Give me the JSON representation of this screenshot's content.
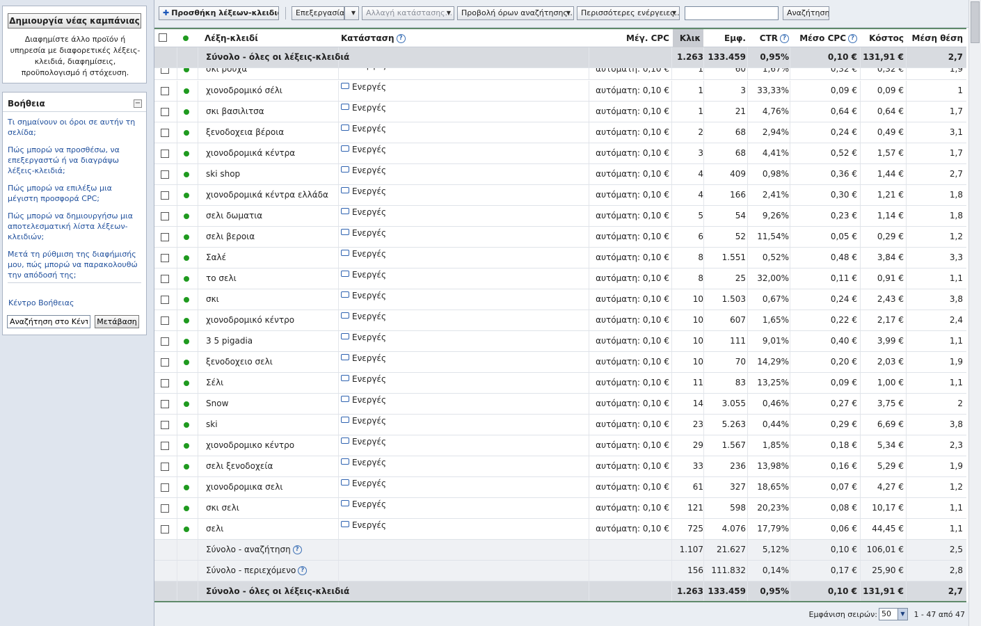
{
  "sidebar": {
    "new_campaign_label": "Δημιουργία νέας καμπάνιας",
    "campaign_desc": "Διαφημίστε άλλο προϊόν ή υπηρεσία με διαφορετικές λέξεις-κλειδιά, διαφημίσεις, προϋπολογισμό ή στόχευση.",
    "help_title": "Βοήθεια",
    "help_links": [
      "Τι σημαίνουν οι όροι σε αυτήν τη σελίδα;",
      "Πώς μπορώ να προσθέσω, να επεξεργαστώ ή να διαγράψω λέξεις-κλειδιά;",
      "Πώς μπορώ να επιλέξω μια μέγιστη προσφορά CPC;",
      "Πώς μπορώ να δημιουργήσω μια αποτελεσματική λίστα λέξεων-κλειδιών;",
      "Μετά τη ρύθμιση της διαφήμισής μου, πώς μπορώ να παρακολουθώ την απόδοσή της;"
    ],
    "help_center": "Κέντρο Βοήθειας",
    "help_search_value": "Αναζήτηση στο Κέντρο Βοήθειας",
    "help_go_label": "Μετάβαση"
  },
  "toolbar": {
    "add_keywords": "Προσθήκη λέξεων-κλειδιών",
    "edit": "Επεξεργασία",
    "change_status": "Αλλαγή κατάστασης...",
    "view_search_terms": "Προβολή όρων αναζήτησης...",
    "more_actions": "Περισσότερες ενέργειες...",
    "search_value": "",
    "search_button": "Αναζήτηση"
  },
  "table": {
    "headers": {
      "keyword": "Λέξη-κλειδί",
      "status": "Κατάσταση",
      "max_cpc": "Μέγ. CPC",
      "clicks": "Κλικ",
      "impressions": "Εμφ.",
      "ctr": "CTR",
      "avg_cpc": "Μέσο CPC",
      "cost": "Κόστος",
      "avg_pos": "Μέση θέση"
    },
    "top_total": {
      "label": "Σύνολο - όλες οι λέξεις-κλειδιά",
      "clicks": "1.263",
      "impressions": "133.459",
      "ctr": "0,95%",
      "avg_cpc": "0,10 €",
      "cost": "131,91 €",
      "avg_pos": "2,7"
    },
    "partial_row": {
      "keyword": "σκι ρούχα",
      "status": "Ενεργές",
      "max_cpc": "αυτόματη: 0,10 €",
      "clicks": "1",
      "impressions": "60",
      "ctr": "1,67%",
      "avg_cpc": "0,32 €",
      "cost": "0,32 €",
      "avg_pos": "1,9"
    },
    "rows": [
      {
        "keyword": "χιονοδρομικό σέλι",
        "status": "Ενεργές",
        "max_cpc": "αυτόματη: 0,10 €",
        "clicks": "1",
        "impressions": "3",
        "ctr": "33,33%",
        "avg_cpc": "0,09 €",
        "cost": "0,09 €",
        "avg_pos": "1"
      },
      {
        "keyword": "σκι βασιλιτσα",
        "status": "Ενεργές",
        "max_cpc": "αυτόματη: 0,10 €",
        "clicks": "1",
        "impressions": "21",
        "ctr": "4,76%",
        "avg_cpc": "0,64 €",
        "cost": "0,64 €",
        "avg_pos": "1,7"
      },
      {
        "keyword": "ξενοδοχεια βέροια",
        "status": "Ενεργές",
        "max_cpc": "αυτόματη: 0,10 €",
        "clicks": "2",
        "impressions": "68",
        "ctr": "2,94%",
        "avg_cpc": "0,24 €",
        "cost": "0,49 €",
        "avg_pos": "3,1"
      },
      {
        "keyword": "χιονοδρομικά κέντρα",
        "status": "Ενεργές",
        "max_cpc": "αυτόματη: 0,10 €",
        "clicks": "3",
        "impressions": "68",
        "ctr": "4,41%",
        "avg_cpc": "0,52 €",
        "cost": "1,57 €",
        "avg_pos": "1,7"
      },
      {
        "keyword": "ski shop",
        "status": "Ενεργές",
        "max_cpc": "αυτόματη: 0,10 €",
        "clicks": "4",
        "impressions": "409",
        "ctr": "0,98%",
        "avg_cpc": "0,36 €",
        "cost": "1,44 €",
        "avg_pos": "2,7"
      },
      {
        "keyword": "χιονοδρομικά κέντρα ελλάδα",
        "status": "Ενεργές",
        "max_cpc": "αυτόματη: 0,10 €",
        "clicks": "4",
        "impressions": "166",
        "ctr": "2,41%",
        "avg_cpc": "0,30 €",
        "cost": "1,21 €",
        "avg_pos": "1,8"
      },
      {
        "keyword": "σελι δωματια",
        "status": "Ενεργές",
        "max_cpc": "αυτόματη: 0,10 €",
        "clicks": "5",
        "impressions": "54",
        "ctr": "9,26%",
        "avg_cpc": "0,23 €",
        "cost": "1,14 €",
        "avg_pos": "1,8"
      },
      {
        "keyword": "σελι βεροια",
        "status": "Ενεργές",
        "max_cpc": "αυτόματη: 0,10 €",
        "clicks": "6",
        "impressions": "52",
        "ctr": "11,54%",
        "avg_cpc": "0,05 €",
        "cost": "0,29 €",
        "avg_pos": "1,2"
      },
      {
        "keyword": "Σαλέ",
        "status": "Ενεργές",
        "max_cpc": "αυτόματη: 0,10 €",
        "clicks": "8",
        "impressions": "1.551",
        "ctr": "0,52%",
        "avg_cpc": "0,48 €",
        "cost": "3,84 €",
        "avg_pos": "3,3"
      },
      {
        "keyword": "το σελι",
        "status": "Ενεργές",
        "max_cpc": "αυτόματη: 0,10 €",
        "clicks": "8",
        "impressions": "25",
        "ctr": "32,00%",
        "avg_cpc": "0,11 €",
        "cost": "0,91 €",
        "avg_pos": "1,1"
      },
      {
        "keyword": "σκι",
        "status": "Ενεργές",
        "max_cpc": "αυτόματη: 0,10 €",
        "clicks": "10",
        "impressions": "1.503",
        "ctr": "0,67%",
        "avg_cpc": "0,24 €",
        "cost": "2,43 €",
        "avg_pos": "3,8"
      },
      {
        "keyword": "χιονοδρομικό κέντρο",
        "status": "Ενεργές",
        "max_cpc": "αυτόματη: 0,10 €",
        "clicks": "10",
        "impressions": "607",
        "ctr": "1,65%",
        "avg_cpc": "0,22 €",
        "cost": "2,17 €",
        "avg_pos": "2,4"
      },
      {
        "keyword": "3 5 pigadia",
        "status": "Ενεργές",
        "max_cpc": "αυτόματη: 0,10 €",
        "clicks": "10",
        "impressions": "111",
        "ctr": "9,01%",
        "avg_cpc": "0,40 €",
        "cost": "3,99 €",
        "avg_pos": "1,1"
      },
      {
        "keyword": "ξενοδοχειο σελι",
        "status": "Ενεργές",
        "max_cpc": "αυτόματη: 0,10 €",
        "clicks": "10",
        "impressions": "70",
        "ctr": "14,29%",
        "avg_cpc": "0,20 €",
        "cost": "2,03 €",
        "avg_pos": "1,9"
      },
      {
        "keyword": "Σέλι",
        "status": "Ενεργές",
        "max_cpc": "αυτόματη: 0,10 €",
        "clicks": "11",
        "impressions": "83",
        "ctr": "13,25%",
        "avg_cpc": "0,09 €",
        "cost": "1,00 €",
        "avg_pos": "1,1"
      },
      {
        "keyword": "Snow",
        "status": "Ενεργές",
        "max_cpc": "αυτόματη: 0,10 €",
        "clicks": "14",
        "impressions": "3.055",
        "ctr": "0,46%",
        "avg_cpc": "0,27 €",
        "cost": "3,75 €",
        "avg_pos": "2"
      },
      {
        "keyword": "ski",
        "status": "Ενεργές",
        "max_cpc": "αυτόματη: 0,10 €",
        "clicks": "23",
        "impressions": "5.263",
        "ctr": "0,44%",
        "avg_cpc": "0,29 €",
        "cost": "6,69 €",
        "avg_pos": "3,8"
      },
      {
        "keyword": "χιονοδρομικο κέντρο",
        "status": "Ενεργές",
        "max_cpc": "αυτόματη: 0,10 €",
        "clicks": "29",
        "impressions": "1.567",
        "ctr": "1,85%",
        "avg_cpc": "0,18 €",
        "cost": "5,34 €",
        "avg_pos": "2,3"
      },
      {
        "keyword": "σελι ξενοδοχεία",
        "status": "Ενεργές",
        "max_cpc": "αυτόματη: 0,10 €",
        "clicks": "33",
        "impressions": "236",
        "ctr": "13,98%",
        "avg_cpc": "0,16 €",
        "cost": "5,29 €",
        "avg_pos": "1,9"
      },
      {
        "keyword": "χιονοδρομικα σελι",
        "status": "Ενεργές",
        "max_cpc": "αυτόματη: 0,10 €",
        "clicks": "61",
        "impressions": "327",
        "ctr": "18,65%",
        "avg_cpc": "0,07 €",
        "cost": "4,27 €",
        "avg_pos": "1,2"
      },
      {
        "keyword": "σκι σελι",
        "status": "Ενεργές",
        "max_cpc": "αυτόματη: 0,10 €",
        "clicks": "121",
        "impressions": "598",
        "ctr": "20,23%",
        "avg_cpc": "0,08 €",
        "cost": "10,17 €",
        "avg_pos": "1,1"
      },
      {
        "keyword": "σελι",
        "status": "Ενεργές",
        "max_cpc": "αυτόματη: 0,10 €",
        "clicks": "725",
        "impressions": "4.076",
        "ctr": "17,79%",
        "avg_cpc": "0,06 €",
        "cost": "44,45 €",
        "avg_pos": "1,1"
      }
    ],
    "subtotals": [
      {
        "label": "Σύνολο - αναζήτηση",
        "clicks": "1.107",
        "impressions": "21.627",
        "ctr": "5,12%",
        "avg_cpc": "0,10 €",
        "cost": "106,01 €",
        "avg_pos": "2,5"
      },
      {
        "label": "Σύνολο - περιεχόμενο",
        "clicks": "156",
        "impressions": "111.832",
        "ctr": "0,14%",
        "avg_cpc": "0,17 €",
        "cost": "25,90 €",
        "avg_pos": "2,8"
      }
    ],
    "bottom_total": {
      "label": "Σύνολο - όλες οι λέξεις-κλειδιά",
      "clicks": "1.263",
      "impressions": "133.459",
      "ctr": "0,95%",
      "avg_cpc": "0,10 €",
      "cost": "131,91 €",
      "avg_pos": "2,7"
    }
  },
  "footer": {
    "rows_label": "Εμφάνιση σειρών:",
    "rows_value": "50",
    "range": "1 - 47 από 47"
  },
  "colors": {
    "active_dot": "#1f9a1f",
    "link": "#1f4f9c",
    "accent_border": "#5f8a6a"
  }
}
